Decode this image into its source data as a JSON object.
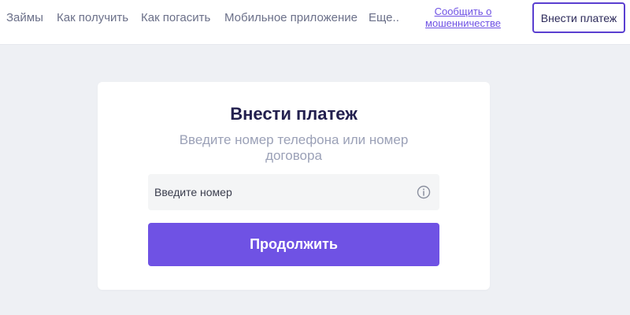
{
  "header": {
    "nav": [
      {
        "label": "Займы"
      },
      {
        "label": "Как получить"
      },
      {
        "label": "Как погасить"
      },
      {
        "label": "Мобильное приложение"
      },
      {
        "label": "Еще.."
      }
    ],
    "fraud_link": "Сообщить о мошенничестве",
    "pay_button": "Внести платеж"
  },
  "form": {
    "title": "Внести платеж",
    "subtitle": "Введите номер телефона или номер договора",
    "input_placeholder": "Введите номер",
    "info_icon": "info-circle-icon",
    "continue_button": "Продолжить"
  },
  "colors": {
    "accent": "#6f52e4",
    "title": "#23204f",
    "background": "#eef0f4"
  }
}
